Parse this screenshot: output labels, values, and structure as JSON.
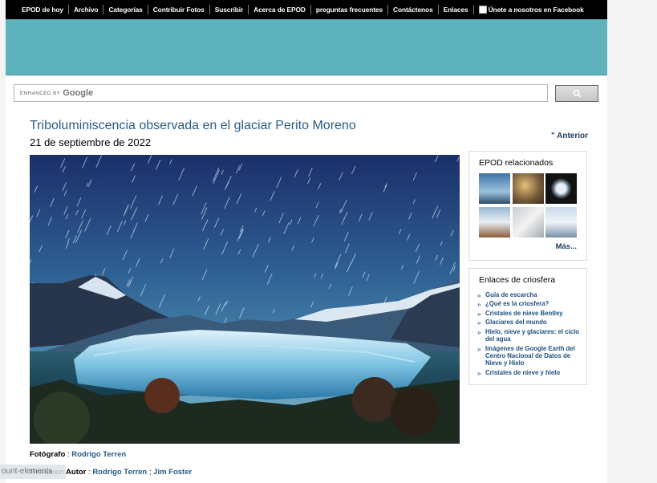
{
  "nav": {
    "items": [
      "EPOD de hoy",
      "Archivo",
      "Categorías",
      "Contribuir Fotos",
      "Suscribir",
      "Acerca de EPOD",
      "preguntas frecuentes",
      "Contáctenos",
      "Enlaces"
    ],
    "facebook": "Únete a nosotros en Facebook"
  },
  "search": {
    "enhanced_by": "ENHANCED BY",
    "brand": "Google"
  },
  "article": {
    "title": "Triboluminiscencia observada en el glaciar Perito Moreno",
    "date": "21 de septiembre de 2022",
    "prev": "\" Anterior",
    "photographer_label": "Fotógrafo",
    "photographer": "Rodrigo Terren",
    "summary_label": "Resumen Autor",
    "authors": [
      "Rodrigo Terren",
      "Jim Foster"
    ]
  },
  "related": {
    "title": "EPOD relacionados",
    "more": "Más..."
  },
  "cryo": {
    "title": "Enlaces de criosfera",
    "links": [
      "Guía de escarcha",
      "¿Qué es la criosfera?",
      "Cristales de nieve Bentley",
      "Glaciares del mundo",
      "Hielo, nieve y glaciares: el ciclo del agua",
      "Imágenes de Google Earth del Centro Nacional de Datos de Nieve y Hielo",
      "Cristales de nieve y hielo"
    ]
  },
  "overlay": {
    "text": "ount-elements"
  },
  "colors": {
    "banner": "#5fb3bd",
    "nav": "#000000",
    "link": "#1f5c8a",
    "title": "#2a5c86"
  }
}
